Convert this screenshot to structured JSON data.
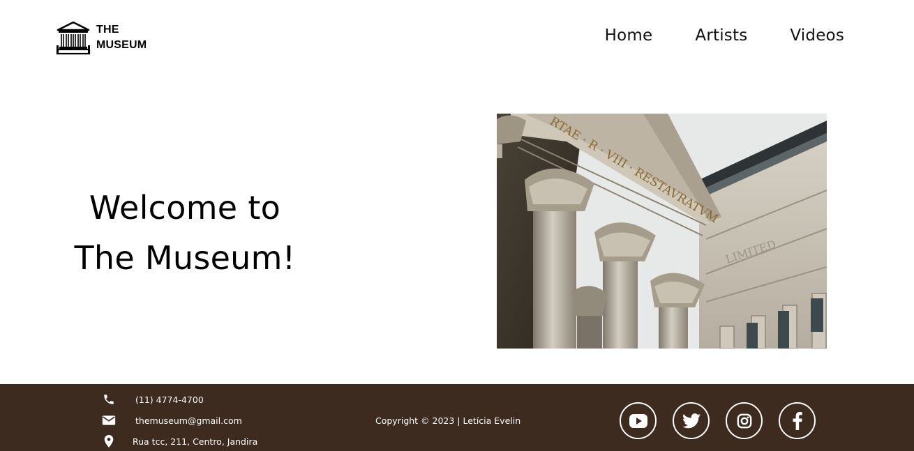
{
  "brand": {
    "name_line1": "THE",
    "name_line2": "MUSEUM",
    "logo_icon": "museum-building-icon"
  },
  "nav": {
    "items": [
      {
        "label": "Home"
      },
      {
        "label": "Artists"
      },
      {
        "label": "Videos"
      }
    ]
  },
  "hero": {
    "title_line1": "Welcome to",
    "title_line2": "The Museum!",
    "photo": "classical-building-photo",
    "photo_inscription": "RTAE · R · VIII · RESTAVRATVM",
    "photo_facade_inscription": "LIMITED"
  },
  "footer": {
    "background_color": "#3d2b1f",
    "phone": {
      "icon": "phone-icon",
      "value": "(11) 4774-4700"
    },
    "email": {
      "icon": "mail-icon",
      "value": "themuseum@gmail.com"
    },
    "address": {
      "icon": "location-pin-icon",
      "value": "Rua tcc, 211, Centro, Jandira"
    },
    "copyright": "Copyright © 2023 | Letícia Evelin",
    "social": [
      {
        "name": "YouTube",
        "icon": "youtube-icon"
      },
      {
        "name": "Twitter",
        "icon": "twitter-icon"
      },
      {
        "name": "Instagram",
        "icon": "instagram-icon"
      },
      {
        "name": "Facebook",
        "icon": "facebook-icon"
      }
    ]
  }
}
